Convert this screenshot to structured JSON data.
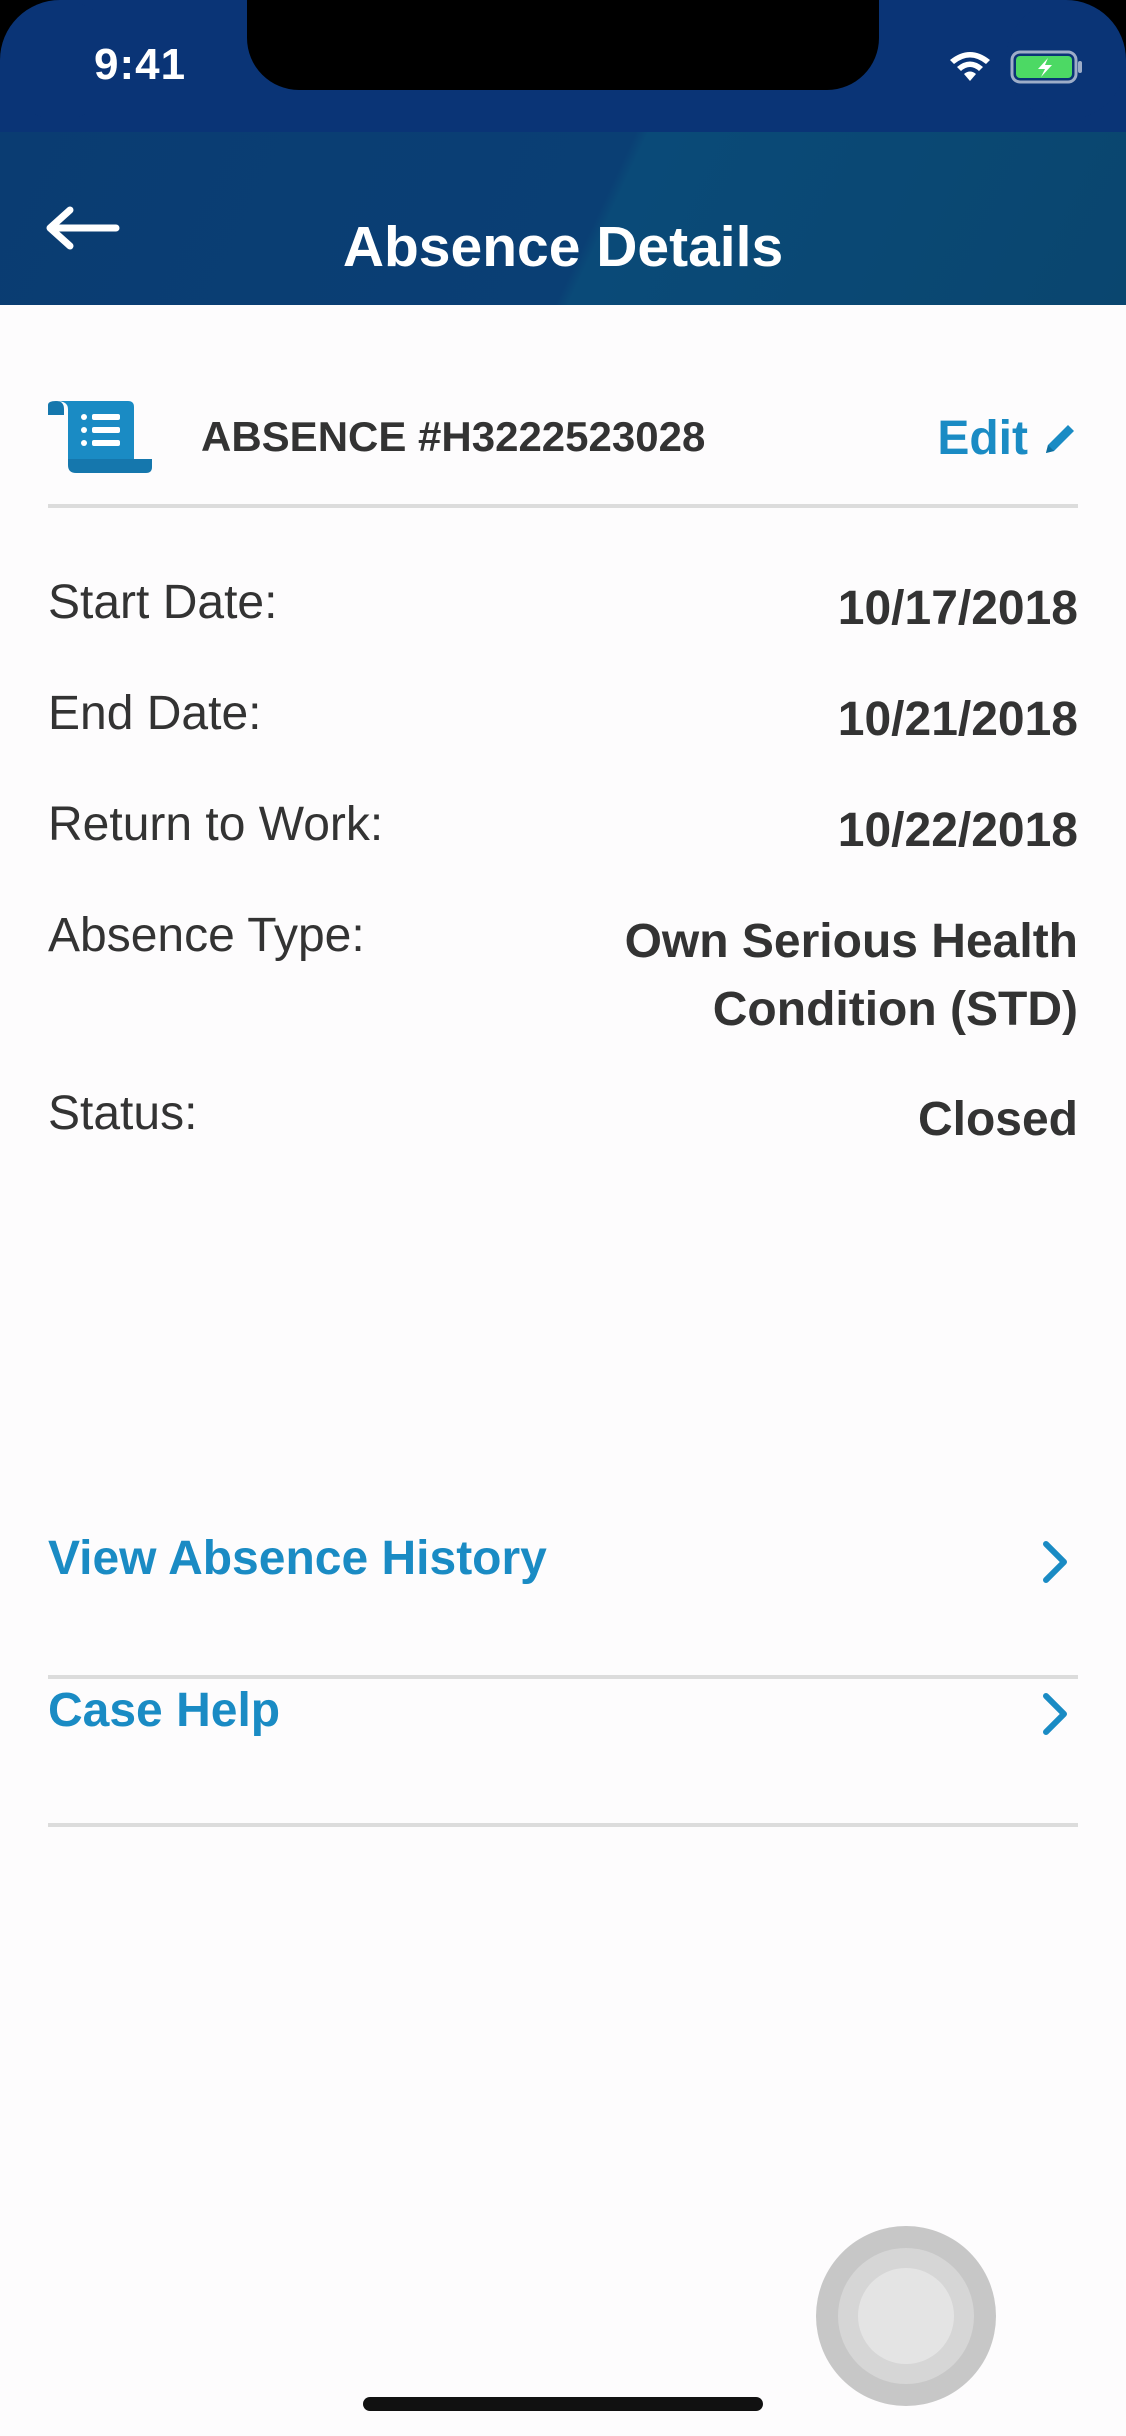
{
  "status_bar": {
    "time": "9:41",
    "icons": [
      "wifi-icon",
      "battery-charging-icon"
    ]
  },
  "header": {
    "back_icon": "arrow-left-icon",
    "title": "Absence Details"
  },
  "absence": {
    "icon": "scroll-document-icon",
    "number": "ABSENCE #H3222523028",
    "edit_label": "Edit",
    "edit_icon": "pencil-icon"
  },
  "details": [
    {
      "label": "Start Date:",
      "value": "10/17/2018"
    },
    {
      "label": "End Date:",
      "value": "10/21/2018"
    },
    {
      "label": "Return to Work:",
      "value": "10/22/2018"
    },
    {
      "label": "Absence Type:",
      "value_line1": "Own Serious Health",
      "value_line2": "Condition (STD)"
    },
    {
      "label": "Status:",
      "value": "Closed"
    }
  ],
  "links": [
    {
      "label": "View Absence History",
      "icon": "chevron-right-icon"
    },
    {
      "label": "Case Help",
      "icon": "chevron-right-icon"
    }
  ],
  "colors": {
    "header_bg": "#0a3c72",
    "accent": "#1a8bc4",
    "text": "#333333",
    "divider": "#dcdcdc"
  }
}
